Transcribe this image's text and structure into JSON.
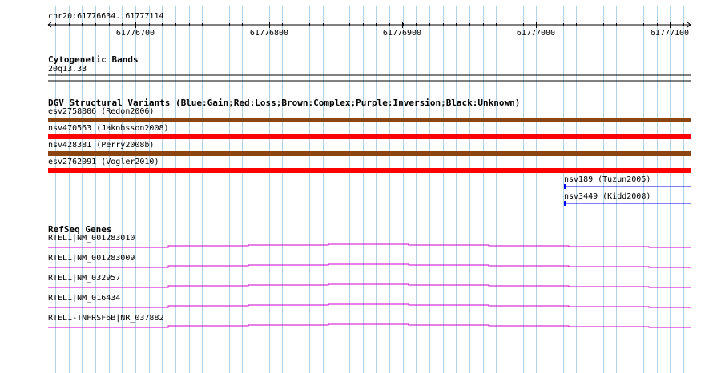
{
  "region": "chr20:61776634..61777114",
  "ruler": {
    "ticks": [
      {
        "label": "61776700",
        "value": 61776700
      },
      {
        "label": "61776800",
        "value": 61776800
      },
      {
        "label": "61776900",
        "value": 61776900
      },
      {
        "label": "61777000",
        "value": 61777000
      },
      {
        "label": "61777100",
        "value": 61777100
      }
    ]
  },
  "tracks": {
    "cytoband": {
      "title": "Cytogenetic Bands",
      "band": "20q13.33"
    },
    "dgv": {
      "title": "DGV Structural Variants (Blue:Gain;Red:Loss;Brown:Complex;Purple:Inversion;Black:Unknown)",
      "features": [
        {
          "label": "esv2758806 (Redon2006)",
          "type": "Complex",
          "color": "#8b4513"
        },
        {
          "label": "nsv470563 (Jakobsson2008)",
          "type": "Loss",
          "color": "#ff0000"
        },
        {
          "label": "nsv428381 (Perry2008b)",
          "type": "Complex",
          "color": "#8b4513"
        },
        {
          "label": "esv2762091 (Vogler2010)",
          "type": "Loss",
          "color": "#ff0000"
        },
        {
          "label": "nsv189 (Tuzun2005)",
          "type": "Gain",
          "color": "#0000ff"
        },
        {
          "label": "nsv3449 (Kidd2008)",
          "type": "Gain",
          "color": "#0000ff"
        }
      ]
    },
    "refseq": {
      "title": "RefSeq Genes",
      "line_color": "#cc00cc",
      "genes": [
        {
          "label": "RTEL1|NM_001283010"
        },
        {
          "label": "RTEL1|NM_001283009"
        },
        {
          "label": "RTEL1|NM_032957"
        },
        {
          "label": "RTEL1|NM_016434"
        },
        {
          "label": "RTEL1-TNFRSF6B|NR_037882"
        }
      ]
    }
  }
}
